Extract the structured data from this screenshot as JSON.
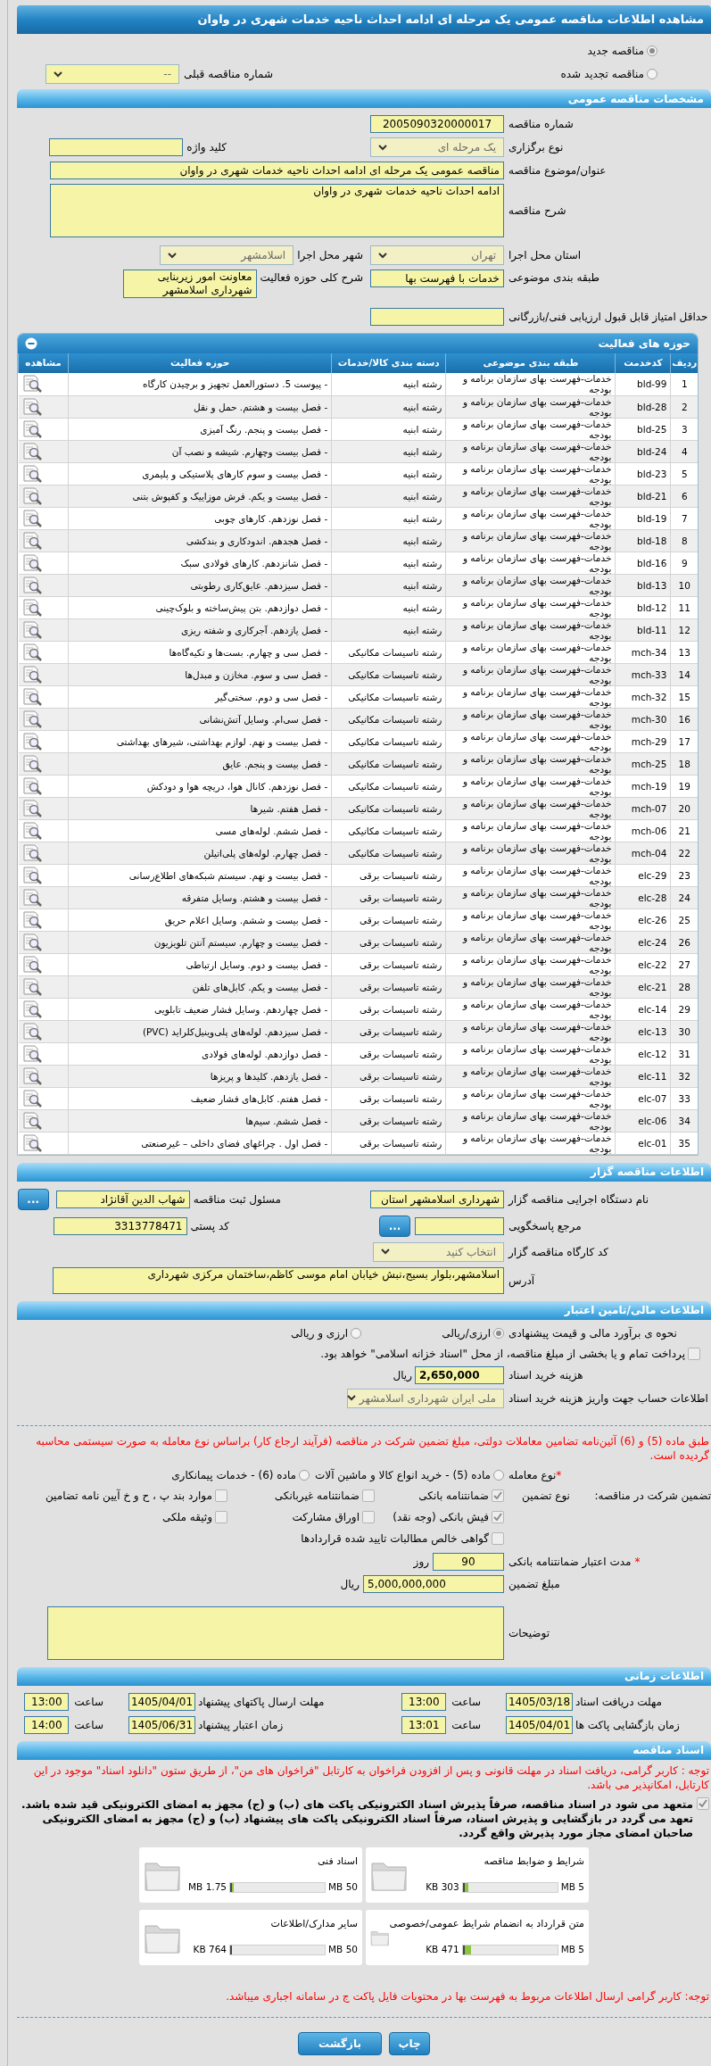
{
  "title": "مشاهده اطلاعات مناقصه عمومی یک مرحله ای ادامه احداث ناحیه خدمات شهری در واوان",
  "tender_status": [
    {
      "label": "مناقصه جدید",
      "selected": true
    },
    {
      "label": "مناقصه تجدید شده",
      "selected": false
    }
  ],
  "previous_tender": {
    "label": "شماره مناقصه قبلی",
    "value": "--"
  },
  "general": {
    "heading": "مشخصات مناقصه عمومی",
    "fields": [
      {
        "kind": "input",
        "label": "شماره مناقصه",
        "value": "2005090320000017"
      },
      {
        "kind": "select",
        "label": "نوع برگزاری",
        "value": "یک مرحله ای"
      },
      {
        "kind": "input",
        "label": "کلید واژه"
      },
      {
        "kind": "input",
        "label": "عنوان/موضوع مناقصه",
        "value": "مناقصه عمومی یک مرحله ای ادامه احداث ناحیه خدمات شهری در واوان"
      },
      {
        "kind": "textarea",
        "label": "شرح مناقصه",
        "value": "ادامه احداث ناحیه خدمات شهری در واوان"
      },
      {
        "kind": "select",
        "label": "استان محل اجرا",
        "value": "تهران"
      },
      {
        "kind": "select",
        "label": "شهر محل اجرا",
        "value": "اسلامشهر"
      },
      {
        "kind": "input",
        "label": "طبقه بندی موضوعی",
        "value": "خدمات با فهرست بها"
      },
      {
        "kind": "textarea",
        "label": "شرح کلی حوزه فعالیت",
        "value": "معاونت امور زیربنایی شهرداری اسلامشهر"
      },
      {
        "kind": "input",
        "label": "حداقل امتیاز قابل قبول ارزیابی فنی/بازرگانی"
      }
    ]
  },
  "activities": {
    "heading": "حوزه های فعالیت",
    "columns": [
      "ردیف",
      "کدخدمت",
      "طبقه بندی موضوعی",
      "دسته بندی کالا/خدمات",
      "حوزه فعالیت",
      "مشاهده"
    ],
    "rows": [
      {
        "no": "1",
        "code": "bld-99",
        "category": "خدمات-فهرست بهای سازمان برنامه و بودجه",
        "group": "رشته ابنیه",
        "activity": "- پیوست 5. دستورالعمل تجهیز و برچیدن کارگاه"
      },
      {
        "no": "2",
        "code": "bld-28",
        "category": "خدمات-فهرست بهای سازمان برنامه و بودجه",
        "group": "رشته ابنیه",
        "activity": "- فصل بیست و هشتم. حمل و نقل"
      },
      {
        "no": "3",
        "code": "bld-25",
        "category": "خدمات-فهرست بهای سازمان برنامه و بودجه",
        "group": "رشته ابنیه",
        "activity": "- فصل بیست و پنجم. رنگ آمیزی"
      },
      {
        "no": "4",
        "code": "bld-24",
        "category": "خدمات-فهرست بهای سازمان برنامه و بودجه",
        "group": "رشته ابنیه",
        "activity": "- فصل بیست وچهارم. شیشه و نصب آن"
      },
      {
        "no": "5",
        "code": "bld-23",
        "category": "خدمات-فهرست بهای سازمان برنامه و بودجه",
        "group": "رشته ابنیه",
        "activity": "- فصل بیست و سوم کارهای پلاستیکی و پلیمری"
      },
      {
        "no": "6",
        "code": "bld-21",
        "category": "خدمات-فهرست بهای سازمان برنامه و بودجه",
        "group": "رشته ابنیه",
        "activity": "- فصل بیست و یکم. فرش موزاییک و کفپوش بتنی"
      },
      {
        "no": "7",
        "code": "bld-19",
        "category": "خدمات-فهرست بهای سازمان برنامه و بودجه",
        "group": "رشته ابنیه",
        "activity": "- فصل نوزدهم. کارهای چوبی"
      },
      {
        "no": "8",
        "code": "bld-18",
        "category": "خدمات-فهرست بهای سازمان برنامه و بودجه",
        "group": "رشته ابنیه",
        "activity": "- فصل هجدهم. اندودکاری و بندکشی"
      },
      {
        "no": "9",
        "code": "bld-16",
        "category": "خدمات-فهرست بهای سازمان برنامه و بودجه",
        "group": "رشته ابنیه",
        "activity": "- فصل شانزدهم. کارهای فولادی سبک"
      },
      {
        "no": "10",
        "code": "bld-13",
        "category": "خدمات-فهرست بهای سازمان برنامه و بودجه",
        "group": "رشته ابنیه",
        "activity": "- فصل سیزدهم. عایق‌کاری رطوبتی"
      },
      {
        "no": "11",
        "code": "bld-12",
        "category": "خدمات-فهرست بهای سازمان برنامه و بودجه",
        "group": "رشته ابنیه",
        "activity": "- فصل دوازدهم. بتن پیش‌ساخته و بلوک‌چینی"
      },
      {
        "no": "12",
        "code": "bld-11",
        "category": "خدمات-فهرست بهای سازمان برنامه و بودجه",
        "group": "رشته ابنیه",
        "activity": "- فصل یازدهم. آجرکاری و شفته ریزی"
      },
      {
        "no": "13",
        "code": "mch-34",
        "category": "خدمات-فهرست بهای سازمان برنامه و بودجه",
        "group": "رشته تاسیسات مکانیکی",
        "activity": "- فصل سی و چهارم. بست‌ها و تکیه‌گاه‌ها"
      },
      {
        "no": "14",
        "code": "mch-33",
        "category": "خدمات-فهرست بهای سازمان برنامه و بودجه",
        "group": "رشته تاسیسات مکانیکی",
        "activity": "- فصل سی و سوم. مخازن و مبدل‌ها"
      },
      {
        "no": "15",
        "code": "mch-32",
        "category": "خدمات-فهرست بهای سازمان برنامه و بودجه",
        "group": "رشته تاسیسات مکانیکی",
        "activity": "- فصل سی و دوم. سختی‌گیر"
      },
      {
        "no": "16",
        "code": "mch-30",
        "category": "خدمات-فهرست بهای سازمان برنامه و بودجه",
        "group": "رشته تاسیسات مکانیکی",
        "activity": "- فصل سی‌ام. وسایل آتش‌نشانی"
      },
      {
        "no": "17",
        "code": "mch-29",
        "category": "خدمات-فهرست بهای سازمان برنامه و بودجه",
        "group": "رشته تاسیسات مکانیکی",
        "activity": "- فصل بیست و نهم. لوازم بهداشتی، شیرهای بهداشتی"
      },
      {
        "no": "18",
        "code": "mch-25",
        "category": "خدمات-فهرست بهای سازمان برنامه و بودجه",
        "group": "رشته تاسیسات مکانیکی",
        "activity": "- فصل بیست و پنجم. عایق"
      },
      {
        "no": "19",
        "code": "mch-19",
        "category": "خدمات-فهرست بهای سازمان برنامه و بودجه",
        "group": "رشته تاسیسات مکانیکی",
        "activity": "- فصل نوزدهم. کانال هوا، دریچه هوا و دودکش"
      },
      {
        "no": "20",
        "code": "mch-07",
        "category": "خدمات-فهرست بهای سازمان برنامه و بودجه",
        "group": "رشته تاسیسات مکانیکی",
        "activity": "- فصل هفتم. شیرها"
      },
      {
        "no": "21",
        "code": "mch-06",
        "category": "خدمات-فهرست بهای سازمان برنامه و بودجه",
        "group": "رشته تاسیسات مکانیکی",
        "activity": "- فصل ششم. لوله‌های مسی"
      },
      {
        "no": "22",
        "code": "mch-04",
        "category": "خدمات-فهرست بهای سازمان برنامه و بودجه",
        "group": "رشته تاسیسات مکانیکی",
        "activity": "- فصل چهارم. لوله‌های پلی‌اتیلن"
      },
      {
        "no": "23",
        "code": "elc-29",
        "category": "خدمات-فهرست بهای سازمان برنامه و بودجه",
        "group": "رشته تاسیسات برقی",
        "activity": "- فصل بیست و نهم. سیستم شبکه‌های اطلاع‌رسانی"
      },
      {
        "no": "24",
        "code": "elc-28",
        "category": "خدمات-فهرست بهای سازمان برنامه و بودجه",
        "group": "رشته تاسیسات برقی",
        "activity": "- فصل بیست و هشتم. وسایل متفرقه"
      },
      {
        "no": "25",
        "code": "elc-26",
        "category": "خدمات-فهرست بهای سازمان برنامه و بودجه",
        "group": "رشته تاسیسات برقی",
        "activity": "- فصل بیست و ششم. وسایل اعلام حریق"
      },
      {
        "no": "26",
        "code": "elc-24",
        "category": "خدمات-فهرست بهای سازمان برنامه و بودجه",
        "group": "رشته تاسیسات برقی",
        "activity": "- فصل بیست و چهارم. سیستم آنتن تلویزیون"
      },
      {
        "no": "27",
        "code": "elc-22",
        "category": "خدمات-فهرست بهای سازمان برنامه و بودجه",
        "group": "رشته تاسیسات برقی",
        "activity": "- فصل بیست و دوم. وسایل ارتباطی"
      },
      {
        "no": "28",
        "code": "elc-21",
        "category": "خدمات-فهرست بهای سازمان برنامه و بودجه",
        "group": "رشته تاسیسات برقی",
        "activity": "- فصل بیست و یکم. کابل‌های تلفن"
      },
      {
        "no": "29",
        "code": "elc-14",
        "category": "خدمات-فهرست بهای سازمان برنامه و بودجه",
        "group": "رشته تاسیسات برقی",
        "activity": "- فصل چهاردهم. وسایل فشار ضعیف تابلویی"
      },
      {
        "no": "30",
        "code": "elc-13",
        "category": "خدمات-فهرست بهای سازمان برنامه و بودجه",
        "group": "رشته تاسیسات برقی",
        "activity": "- فصل سیزدهم. لوله‌های پلی‌وینیل‌کلراید (PVC)"
      },
      {
        "no": "31",
        "code": "elc-12",
        "category": "خدمات-فهرست بهای سازمان برنامه و بودجه",
        "group": "رشته تاسیسات برقی",
        "activity": "- فصل دوازدهم. لوله‌های فولادی"
      },
      {
        "no": "32",
        "code": "elc-11",
        "category": "خدمات-فهرست بهای سازمان برنامه و بودجه",
        "group": "رشته تاسیسات برقی",
        "activity": "- فصل یازدهم. کلیدها و پریزها"
      },
      {
        "no": "33",
        "code": "elc-07",
        "category": "خدمات-فهرست بهای سازمان برنامه و بودجه",
        "group": "رشته تاسیسات برقی",
        "activity": "- فصل هفتم. کابل‌های فشار ضعیف"
      },
      {
        "no": "34",
        "code": "elc-06",
        "category": "خدمات-فهرست بهای سازمان برنامه و بودجه",
        "group": "رشته تاسیسات برقی",
        "activity": "- فصل ششم. سیم‌ها"
      },
      {
        "no": "35",
        "code": "elc-01",
        "category": "خدمات-فهرست بهای سازمان برنامه و بودجه",
        "group": "رشته تاسیسات برقی",
        "activity": "- فصل اول . چراغهای فضای داخلی – غیرصنعتی"
      }
    ]
  },
  "organizer": {
    "heading": "اطلاعات مناقصه گزار",
    "fields": [
      {
        "kind": "input",
        "label": "نام دستگاه اجرایی مناقصه گزار",
        "value": "شهرداری اسلامشهر استان"
      },
      {
        "kind": "input",
        "label": "مسئول ثبت مناقصه",
        "value": "شهاب الدین آقانژاد",
        "button": "..."
      },
      {
        "kind": "input",
        "label": "مرجع پاسخگویی",
        "button": "..."
      },
      {
        "kind": "input",
        "label": "کد پستی",
        "value": "3313778471"
      },
      {
        "kind": "select",
        "label": "کد کارگاه مناقصه گزار",
        "value": "انتخاب کنید"
      },
      {
        "kind": "textarea",
        "label": "آدرس",
        "value": "اسلامشهر،بلوار بسیج،نبش خیابان امام موسی کاظم،ساختمان مرکزی شهرداری"
      }
    ]
  },
  "financial": {
    "heading": "اطلاعات مالی/تامین اعتبار",
    "estimate": {
      "label": "نحوه ی برآورد مالی و قیمت پیشنهادی",
      "options": [
        {
          "label": "ارزی/ریالی",
          "selected": true
        },
        {
          "label": "ارزی و ریالی",
          "selected": false
        }
      ]
    },
    "treasury": {
      "label": "پرداخت تمام و یا بخشی از مبلغ مناقصه، از محل \"اسناد خزانه اسلامی\" خواهد بود.",
      "checked": false
    },
    "doc_fee": {
      "label": "هزینه خرید اسناد",
      "value": "2,650,000",
      "unit": "ریال"
    },
    "account": {
      "label": "اطلاعات حساب جهت واریز هزینه خرید اسناد",
      "value": "ملی ایران شهرداری اسلامشهر"
    },
    "notice": "طبق ماده (5) و (6) آئین‌نامه تضامین معاملات دولتی، مبلغ تضمین شرکت در مناقصه (فرآیند ارجاع کار) براساس نوع معامله به صورت سیستمی محاسبه گردیده است.",
    "deal_type": {
      "mark": "*",
      "label": "نوع معامله",
      "options": [
        {
          "label": "ماده (5) - خرید انواع کالا و ماشین آلات",
          "selected": false
        },
        {
          "label": "ماده (6) - خدمات پیمانکاری",
          "selected": false
        }
      ]
    },
    "guarantee": {
      "label": "تضمین شرکت در مناقصه:",
      "type_label": "نوع تضمین",
      "options": [
        {
          "label": "ضمانتنامه بانکی",
          "checked": true
        },
        {
          "label": "ضمانتنامه غیربانکی",
          "checked": false
        },
        {
          "label": "موارد بند پ ، ح و خ آیین نامه تضامین",
          "checked": false
        },
        {
          "label": "فیش بانکی (وجه نقد)",
          "checked": true
        },
        {
          "label": "اوراق مشارکت",
          "checked": false
        },
        {
          "label": "وثیقه ملکی",
          "checked": false
        },
        {
          "label": "گواهی خالص مطالبات تایید شده قراردادها",
          "checked": false
        }
      ]
    },
    "validity": {
      "mark": "*",
      "label": "مدت اعتبار ضمانتنامه بانکی",
      "value": "90",
      "unit": "روز"
    },
    "amount": {
      "label": "مبلغ تضمین",
      "value": "5,000,000,000",
      "unit": "ریال"
    },
    "notes": {
      "label": "توضیحات"
    }
  },
  "timing": {
    "heading": "اطلاعات زمانی",
    "entries": [
      {
        "label": "مهلت دریافت اسناد",
        "date": "1405/03/18",
        "time_label": "ساعت",
        "time": "13:00"
      },
      {
        "label": "مهلت ارسال پاکتهای پیشنهاد",
        "date": "1405/04/01",
        "time_label": "ساعت",
        "time": "13:00"
      },
      {
        "label": "زمان بازگشایی پاکت ها",
        "date": "1405/04/01",
        "time_label": "ساعت",
        "time": "13:01"
      },
      {
        "label": "زمان اعتبار پیشنهاد",
        "date": "1405/06/31",
        "time_label": "ساعت",
        "time": "14:00"
      }
    ]
  },
  "documents": {
    "heading": "اسناد مناقصه",
    "notice": "توجه : کاربر گرامی، دریافت اسناد در مهلت قانونی و پس از افزودن فراخوان به کارتابل \"فراخوان های من\"، از طریق ستون \"دانلود اسناد\" موجود در این کارتابل، امکانپذیر می باشد.",
    "commitment": {
      "text": "متعهد می شود در اسناد مناقصه، صرفاً پذیرش اسناد الکترونیکی پاکت های (ب) و (ج) مجهز به امضای الکترونیکی قید شده باشد. تعهد می گردد در بازگشایی و پذیرش اسناد، صرفاً اسناد الکترونیکی پاکت های پیشنهاد (ب) و (ج) مجهز به امضای الکترونیکی صاحبان امضای مجاز مورد پذیرش واقع گردد.",
      "checked": true
    },
    "files": [
      {
        "name": "شرایط و ضوابط مناقصه",
        "size": "303 KB",
        "max": "5 MB",
        "level": 0.06
      },
      {
        "name": "اسناد فنی",
        "size": "1.75 MB",
        "max": "50 MB",
        "level": 0.035
      },
      {
        "name": "متن قرارداد به انضمام شرایط عمومی/خصوصی",
        "size": "471 KB",
        "max": "5 MB",
        "level": 0.09
      },
      {
        "name": "سایر مدارک/اطلاعات",
        "size": "764 KB",
        "max": "50 MB",
        "level": 0.015
      }
    ],
    "note": "توجه: کاربر گرامی ارسال اطلاعات مربوط به فهرست بها در محتویات فایل پاکت ج در سامانه اجباری میباشد.",
    "buttons": [
      "چاپ",
      "بازگشت"
    ]
  }
}
